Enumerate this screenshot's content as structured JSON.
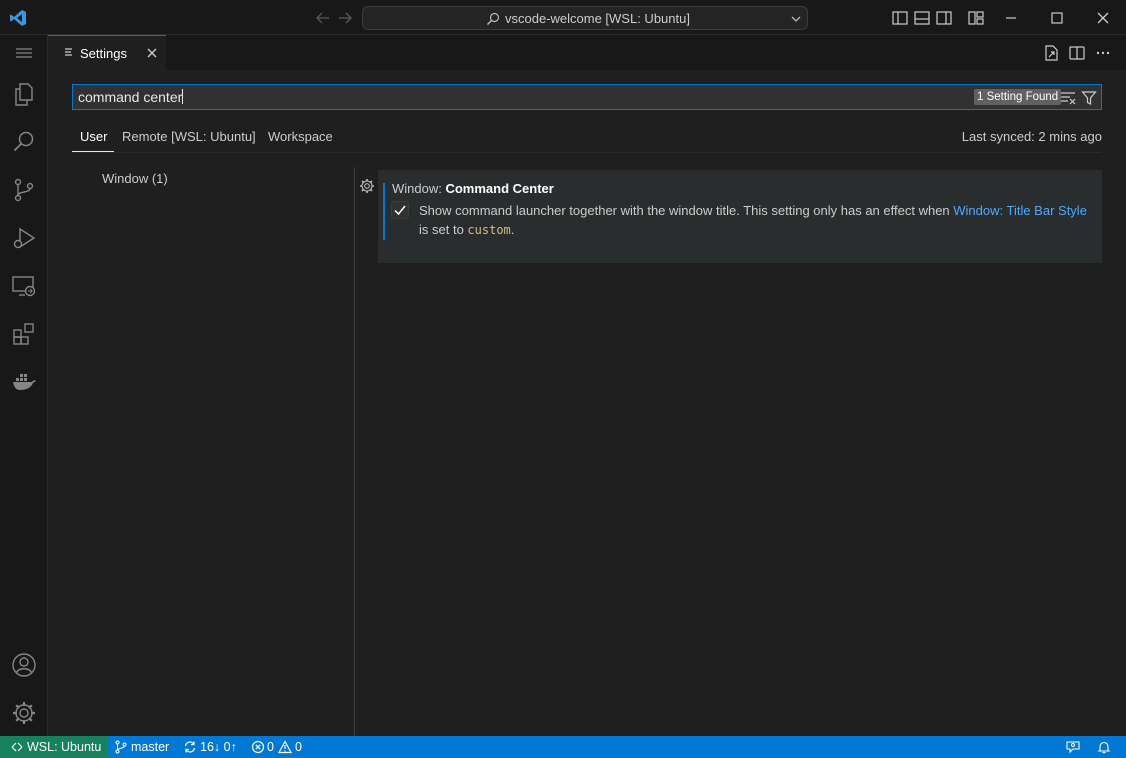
{
  "titlebar": {
    "search_text": "vscode-welcome [WSL: Ubuntu]",
    "icons": [
      "vscode-logo-icon",
      "back-arrow-icon",
      "forward-arrow-icon",
      "search-icon",
      "chevron-down-icon",
      "toggle-primary-sidebar-icon",
      "toggle-panel-icon",
      "toggle-secondary-sidebar-icon",
      "customize-layout-icon",
      "minimize-icon",
      "maximize-icon",
      "close-icon"
    ]
  },
  "activitybar": {
    "items": [
      "menu-icon",
      "explorer-icon",
      "search-icon",
      "source-control-icon",
      "run-debug-icon",
      "remote-explorer-icon",
      "extensions-icon",
      "docker-icon",
      "accounts-icon",
      "manage-gear-icon"
    ]
  },
  "editor_tab": {
    "label": "Settings",
    "actions": [
      "open-settings-json-icon",
      "split-editor-icon",
      "more-actions-icon"
    ]
  },
  "settings": {
    "search_value": "command center",
    "result_count": "1 Setting Found",
    "scopes": [
      {
        "label": "User",
        "active": true
      },
      {
        "label": "Remote [WSL: Ubuntu]",
        "active": false
      },
      {
        "label": "Workspace",
        "active": false
      }
    ],
    "last_synced": "Last synced: 2 mins ago",
    "toc": [
      {
        "label": "Window (1)"
      }
    ],
    "setting": {
      "category": "Window: ",
      "name": "Command Center",
      "checked": true,
      "description_part1": "Show command launcher together with the window title. This setting only has an effect when ",
      "description_link": "Window: Title Bar Style",
      "description_part2": "is set to ",
      "description_code": "custom",
      "description_end": "."
    }
  },
  "statusbar": {
    "remote": "WSL: Ubuntu",
    "branch": "master",
    "sync": "16↓ 0↑",
    "errors": "0",
    "warnings": "0"
  },
  "colors": {
    "accent": "#0078d4",
    "remote_bg": "#16825d",
    "link": "#4daafc",
    "code": "#d7ba7d"
  }
}
